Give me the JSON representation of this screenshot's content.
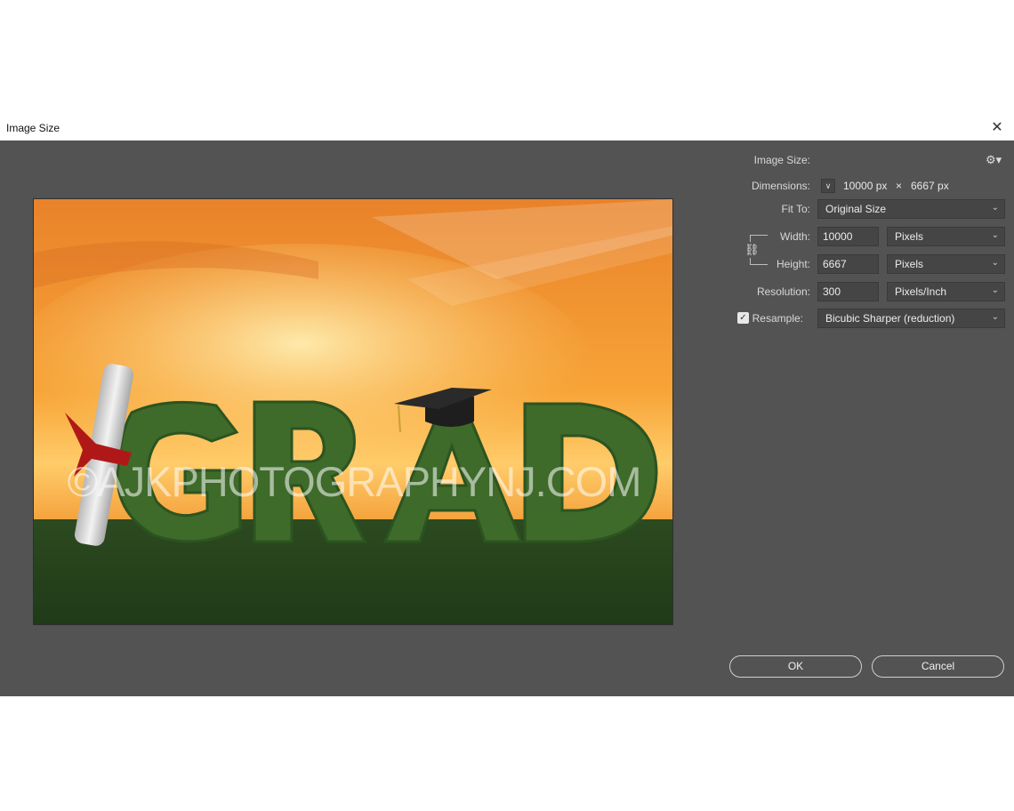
{
  "window": {
    "title": "Image Size"
  },
  "preview": {
    "watermark": "©AJKPHOTOGRAPHYNJ.COM"
  },
  "panel": {
    "image_size_label": "Image Size:",
    "dimensions_label": "Dimensions:",
    "dimensions_width": "10000 px",
    "dimensions_x": "×",
    "dimensions_height": "6667 px",
    "fit_to_label": "Fit To:",
    "fit_to_value": "Original Size",
    "width_label": "Width:",
    "width_value": "10000",
    "width_unit": "Pixels",
    "height_label": "Height:",
    "height_value": "6667",
    "height_unit": "Pixels",
    "resolution_label": "Resolution:",
    "resolution_value": "300",
    "resolution_unit": "Pixels/Inch",
    "resample_label": "Resample:",
    "resample_checked": true,
    "resample_value": "Bicubic Sharper (reduction)"
  },
  "buttons": {
    "ok": "OK",
    "cancel": "Cancel"
  },
  "icons": {
    "close": "close-icon",
    "gear": "gear-icon",
    "link": "link-icon",
    "chevron": "chevron-down-icon"
  },
  "colors": {
    "dialog_bg": "#535353",
    "field_bg": "#454545",
    "sky_top": "#f08a2a",
    "sky_glow": "#ffd27a",
    "grass": "#2e4a22",
    "hedge": "#3f6a2a"
  }
}
